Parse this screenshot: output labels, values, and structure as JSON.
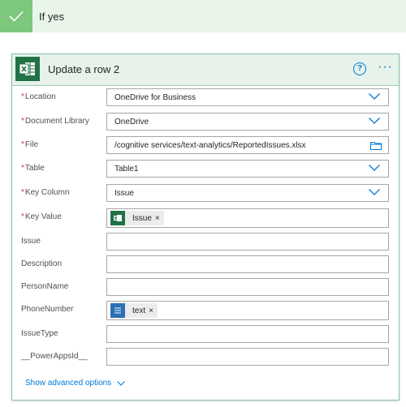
{
  "condition": {
    "title": "If yes"
  },
  "action": {
    "title": "Update a row 2",
    "help_icon": "question-circle-icon",
    "more_icon": "ellipsis-icon"
  },
  "required_marker": "*",
  "fields": [
    {
      "label": "Location",
      "required": true,
      "value": "OneDrive for Business",
      "type": "dropdown"
    },
    {
      "label": "Document Library",
      "required": true,
      "value": "OneDrive",
      "type": "dropdown"
    },
    {
      "label": "File",
      "required": true,
      "value": "/cognitive services/text-analytics/ReportedIssues.xlsx",
      "type": "file"
    },
    {
      "label": "Table",
      "required": true,
      "value": "Table1",
      "type": "dropdown"
    },
    {
      "label": "Key Column",
      "required": true,
      "value": "Issue",
      "type": "dropdown"
    },
    {
      "label": "Key Value",
      "required": true,
      "token": "Issue",
      "token_icon": "excel-icon",
      "type": "token"
    },
    {
      "label": "Issue",
      "required": false,
      "value": "",
      "type": "text"
    },
    {
      "label": "Description",
      "required": false,
      "value": "",
      "type": "text"
    },
    {
      "label": "PersonName",
      "required": false,
      "value": "",
      "type": "text"
    },
    {
      "label": "PhoneNumber",
      "required": false,
      "token": "text",
      "token_icon": "text-analytics-icon",
      "type": "token"
    },
    {
      "label": "IssueType",
      "required": false,
      "value": "",
      "type": "text"
    },
    {
      "label": "__PowerAppsId__",
      "required": false,
      "value": "",
      "type": "text"
    }
  ],
  "token_remove": "×",
  "advanced": {
    "label": "Show advanced options"
  },
  "colors": {
    "accent": "#0078d4",
    "excel_green": "#217346",
    "check_green": "#7dc87d",
    "required_red": "#d13438"
  }
}
